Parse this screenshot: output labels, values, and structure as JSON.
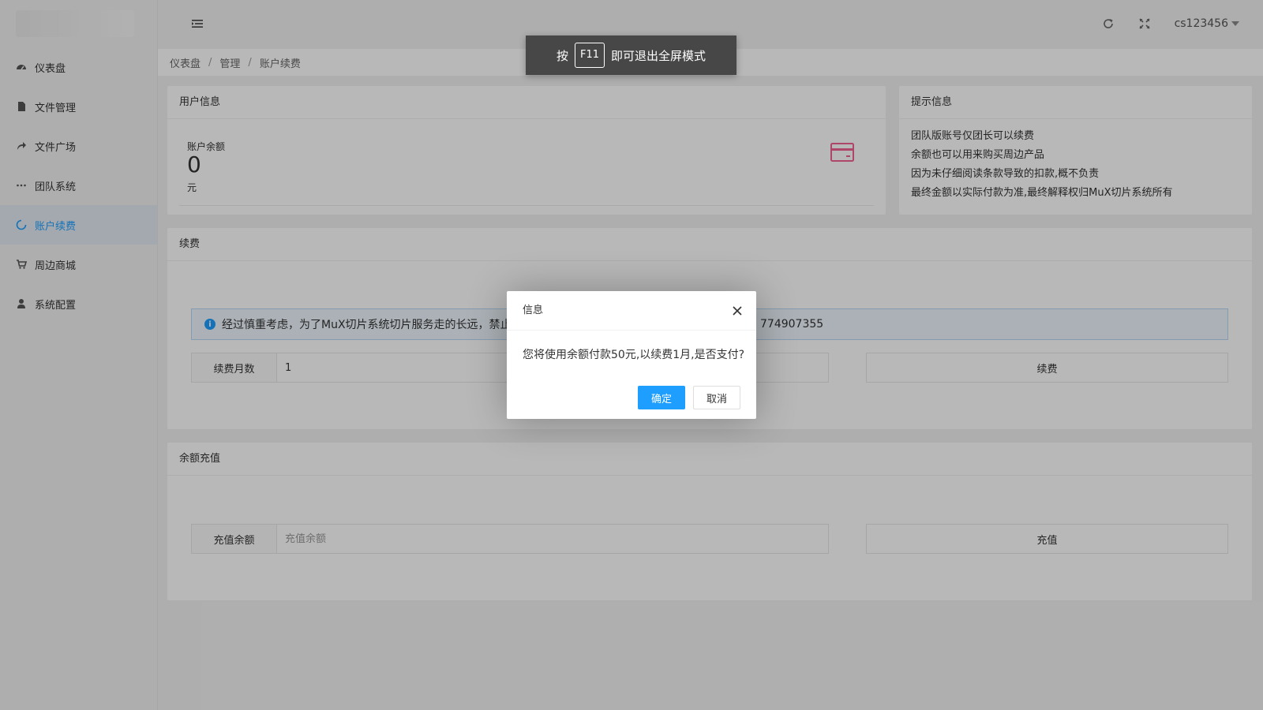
{
  "sidebar": {
    "items": [
      {
        "label": "仪表盘",
        "icon": "dashboard-icon"
      },
      {
        "label": "文件管理",
        "icon": "file-icon"
      },
      {
        "label": "文件广场",
        "icon": "share-icon"
      },
      {
        "label": "团队系统",
        "icon": "ellipsis-icon"
      },
      {
        "label": "账户续费",
        "icon": "circle-icon",
        "active": true
      },
      {
        "label": "周边商城",
        "icon": "cart-icon"
      },
      {
        "label": "系统配置",
        "icon": "user-icon"
      }
    ]
  },
  "header": {
    "username": "cs123456",
    "icons": [
      "menu-toggle-icon",
      "refresh-icon",
      "fullscreen-icon"
    ]
  },
  "breadcrumb": {
    "items": [
      "仪表盘",
      "管理",
      "账户续费"
    ],
    "separator": "/"
  },
  "user_info": {
    "title": "用户信息",
    "balance_label": "账户余额",
    "balance_value": "0",
    "balance_unit": "元",
    "icon": "credit-card-icon",
    "icon_color": "#f06292"
  },
  "tips": {
    "title": "提示信息",
    "lines": [
      "团队版账号仅团长可以续费",
      "余额也可以用来购买周边产品",
      "因为未仔细阅读条款导致的扣款,概不负责",
      "最终金额以实际付款为准,最终解释权归MuX切片系统所有"
    ]
  },
  "renew": {
    "title": "续费",
    "alert_text": "经过慎重考虑，为了MuX切片系统切片服务走的长远，禁止",
    "alert_tail": "774907355",
    "months_label": "续费月数",
    "months_value": "1",
    "button": "续费"
  },
  "recharge": {
    "title": "余额充值",
    "amount_label": "充值余额",
    "amount_placeholder": "充值余额",
    "button": "充值"
  },
  "fullscreen_toast": {
    "prefix": "按",
    "key": "F11",
    "suffix": "即可退出全屏模式"
  },
  "dialog": {
    "title": "信息",
    "message": "您将使用余额付款50元,以续费1月,是否支付?",
    "confirm": "确定",
    "cancel": "取消"
  },
  "colors": {
    "accent": "#1e9fff",
    "active_bg": "#e2ebf3"
  }
}
